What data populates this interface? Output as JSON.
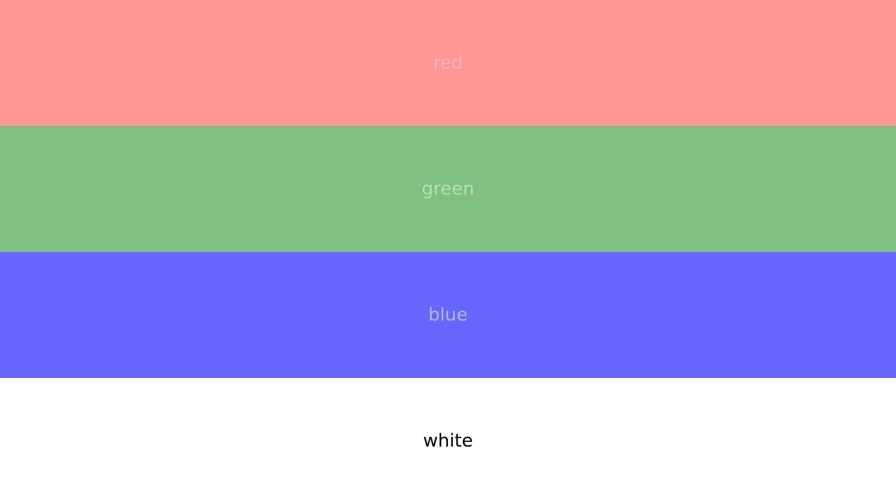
{
  "bands": [
    {
      "label": "red",
      "background": "#ff9696",
      "text_color": "#ffb6b6"
    },
    {
      "label": "green",
      "background": "#80c080",
      "text_color": "#b8dfb0"
    },
    {
      "label": "blue",
      "background": "#6666ff",
      "text_color": "#b0b8e8"
    },
    {
      "label": "white",
      "background": "#ffffff",
      "text_color": "#000000"
    }
  ]
}
